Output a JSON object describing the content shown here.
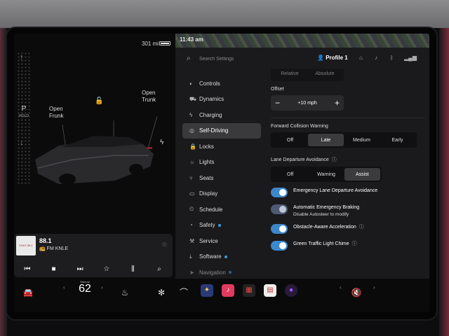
{
  "car": {
    "range": "301 mi",
    "gear_selected": "P",
    "gear_hold": "HOLD",
    "frunk_line1": "Open",
    "frunk_line2": "Frunk",
    "trunk_line1": "Open",
    "trunk_line2": "Trunk"
  },
  "media": {
    "frequency": "88.1",
    "station": "FM KNLE",
    "thumb_text": "KNLE 88.1"
  },
  "status": {
    "time": "11:43 am"
  },
  "topbar": {
    "search_placeholder": "Search Settings",
    "profile": "Profile 1"
  },
  "nav": {
    "items": [
      {
        "label": "Controls",
        "icon": "toggle-icon"
      },
      {
        "label": "Dynamics",
        "icon": "car-icon"
      },
      {
        "label": "Charging",
        "icon": "bolt-icon"
      },
      {
        "label": "Self-Driving",
        "icon": "steering-wheel-icon",
        "active": true
      },
      {
        "label": "Locks",
        "icon": "lock-icon"
      },
      {
        "label": "Lights",
        "icon": "light-icon"
      },
      {
        "label": "Seats",
        "icon": "seat-icon"
      },
      {
        "label": "Display",
        "icon": "display-icon"
      },
      {
        "label": "Schedule",
        "icon": "clock-icon"
      },
      {
        "label": "Safety",
        "icon": "shield-icon",
        "dot": true
      },
      {
        "label": "Service",
        "icon": "wrench-icon"
      },
      {
        "label": "Software",
        "icon": "download-icon",
        "dot": true
      },
      {
        "label": "Navigation",
        "icon": "nav-icon",
        "dot": true
      }
    ]
  },
  "content": {
    "offset_mode_options": [
      "Relative",
      "Absolute"
    ],
    "offset_label": "Offset",
    "offset_value": "+10 mph",
    "fcw_label": "Forward Collision Warning",
    "fcw_options": [
      "Off",
      "Late",
      "Medium",
      "Early"
    ],
    "fcw_selected": "Late",
    "lda_label": "Lane Departure Avoidance",
    "lda_options": [
      "Off",
      "Warning",
      "Assist"
    ],
    "lda_selected": "Assist",
    "toggles": [
      {
        "label": "Emergency Lane Departure Avoidance",
        "sub": "",
        "on": true,
        "info": false
      },
      {
        "label": "Automatic Emergency Braking",
        "sub": "Disable Autosteer to modify",
        "on": true,
        "disabled": true,
        "info": false
      },
      {
        "label": "Obstacle-Aware Acceleration",
        "sub": "",
        "on": true,
        "info": true
      },
      {
        "label": "Green Traffic Light Chime",
        "sub": "",
        "on": true,
        "info": true
      }
    ]
  },
  "taskbar": {
    "temp_label": "Manual",
    "temperature": "62"
  },
  "colors": {
    "accent": "#3d88cc",
    "panel": "#1a1a1c",
    "selected_segment": "#3b3b3e"
  }
}
